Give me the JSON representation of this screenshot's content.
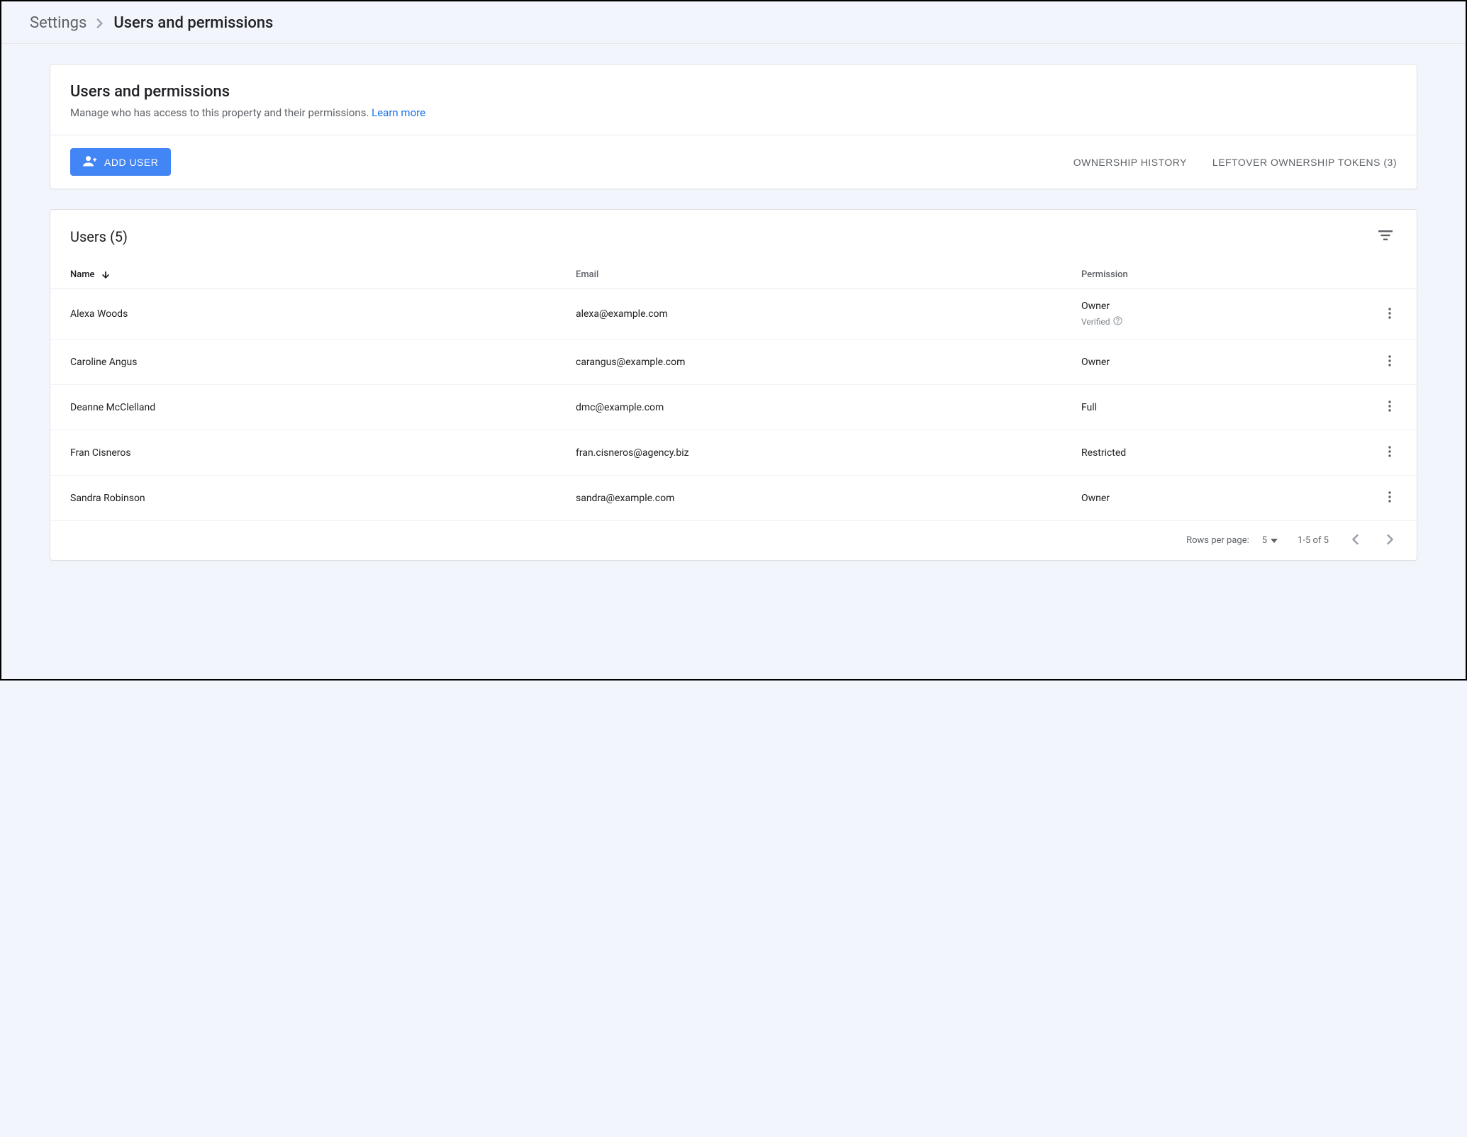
{
  "breadcrumb": {
    "parent": "Settings",
    "current": "Users and permissions"
  },
  "header_card": {
    "title": "Users and permissions",
    "subtitle": "Manage who has access to this property and their permissions. ",
    "learn_more": "Learn more",
    "add_user": "ADD USER",
    "ownership_history": "OWNERSHIP HISTORY",
    "leftover_tokens": "LEFTOVER OWNERSHIP TOKENS (3)"
  },
  "table": {
    "title": "Users (5)",
    "columns": {
      "name": "Name",
      "email": "Email",
      "permission": "Permission"
    },
    "verified_label": "Verified",
    "rows": [
      {
        "name": "Alexa Woods",
        "email": "alexa@example.com",
        "permission": "Owner",
        "verified": true
      },
      {
        "name": "Caroline Angus",
        "email": "carangus@example.com",
        "permission": "Owner",
        "verified": false
      },
      {
        "name": "Deanne McClelland",
        "email": "dmc@example.com",
        "permission": "Full",
        "verified": false
      },
      {
        "name": "Fran Cisneros",
        "email": "fran.cisneros@agency.biz",
        "permission": "Restricted",
        "verified": false
      },
      {
        "name": "Sandra Robinson",
        "email": "sandra@example.com",
        "permission": "Owner",
        "verified": false
      }
    ]
  },
  "pagination": {
    "rows_per_page_label": "Rows per page:",
    "rows_per_page_value": "5",
    "range": "1-5 of 5"
  }
}
